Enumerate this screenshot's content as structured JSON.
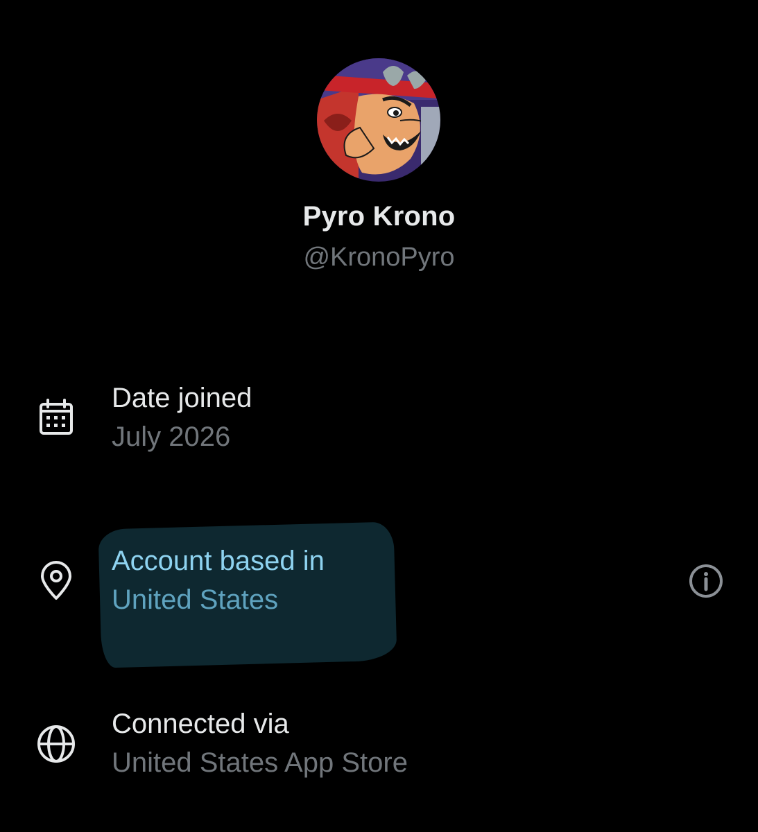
{
  "profile": {
    "display_name": "Pyro Krono",
    "handle": "@KronoPyro",
    "avatar_icon": "cartoon-villain-avatar"
  },
  "rows": {
    "date_joined": {
      "icon": "calendar-icon",
      "label": "Date joined",
      "value": "July 2026"
    },
    "account_based": {
      "icon": "location-pin-icon",
      "label": "Account based in",
      "value": "United States",
      "highlight_color": "#0f2a33",
      "info_icon": "info-circle-icon"
    },
    "connected_via": {
      "icon": "globe-icon",
      "label": "Connected via",
      "value": "United States App Store"
    }
  },
  "colors": {
    "background": "#000000",
    "primary_text": "#e7e9ea",
    "secondary_text": "#71767b",
    "highlight_text": "#8ed3f0"
  }
}
